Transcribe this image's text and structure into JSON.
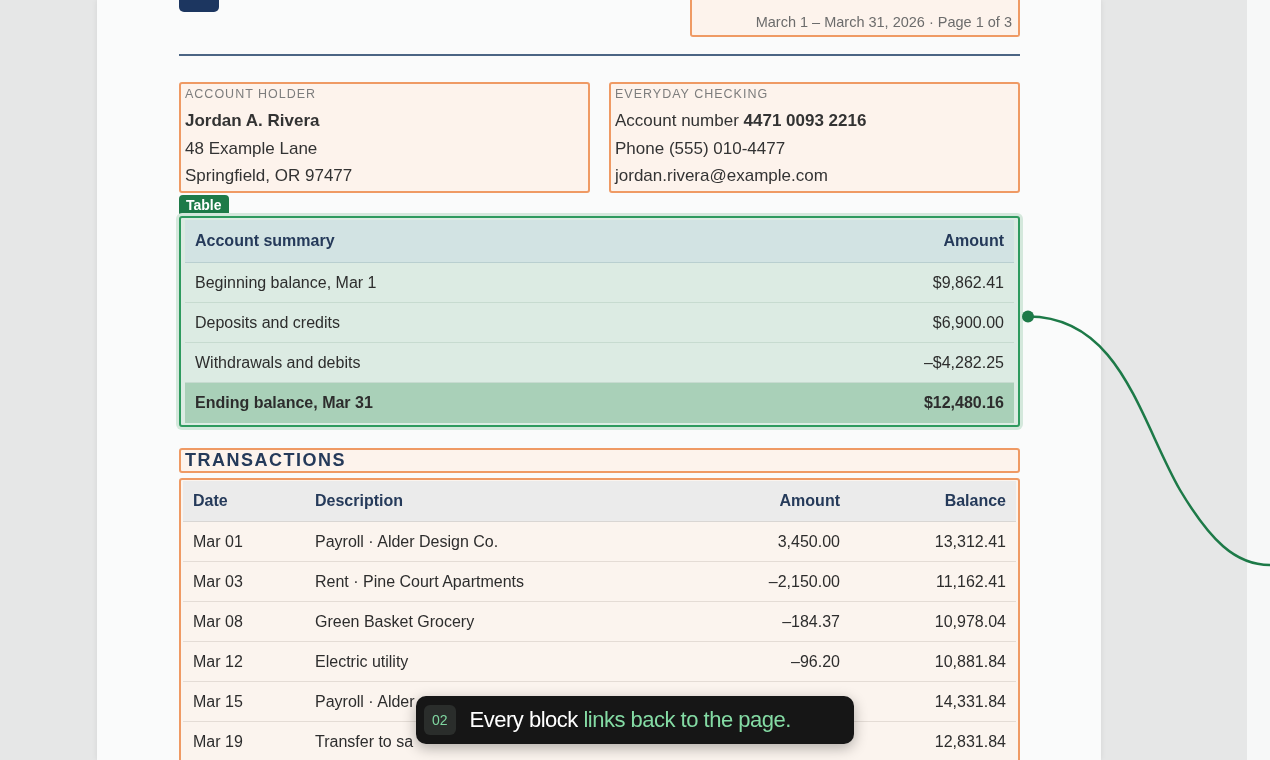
{
  "header": {
    "period": "March 1 – March 31, 2026 · Page 1 of 3"
  },
  "holder": {
    "label": "ACCOUNT HOLDER",
    "name": "Jordan A. Rivera",
    "lines": [
      "48 Example Lane",
      "Springfield, OR 97477"
    ]
  },
  "account": {
    "label": "EVERYDAY CHECKING",
    "number_label": "Account number ",
    "number": "4471 0093 2216",
    "lines": [
      "Phone (555) 010-4477",
      "jordan.rivera@example.com"
    ]
  },
  "summary": {
    "tag": "Table",
    "columns": [
      "Account summary",
      "Amount"
    ],
    "rows": [
      {
        "kind": "line",
        "label": "Beginning balance, Mar 1",
        "amount": "$9,862.41"
      },
      {
        "kind": "line",
        "label": "Deposits and credits",
        "amount": "$6,900.00",
        "linked": true
      },
      {
        "kind": "line",
        "label": "Withdrawals and debits",
        "amount": "–$4,282.25"
      },
      {
        "kind": "total",
        "label": "Ending balance, Mar 31",
        "amount": "$12,480.16"
      }
    ]
  },
  "transactions": {
    "title": "TRANSACTIONS",
    "columns": [
      "Date",
      "Description",
      "Amount",
      "Balance"
    ],
    "rows": [
      {
        "date": "Mar 01",
        "description": "Payroll · Alder Design Co.",
        "amount": "3,450.00",
        "balance": "13,312.41"
      },
      {
        "date": "Mar 03",
        "description": "Rent · Pine Court Apartments",
        "amount": "–2,150.00",
        "balance": "11,162.41"
      },
      {
        "date": "Mar 08",
        "description": "Green Basket Grocery",
        "amount": "–184.37",
        "balance": "10,978.04"
      },
      {
        "date": "Mar 12",
        "description": "Electric utility",
        "amount": "–96.20",
        "balance": "10,881.84"
      },
      {
        "date": "Mar 15",
        "description": "Payroll · Alder",
        "balance": "14,331.84"
      },
      {
        "date": "Mar 19",
        "description": "Transfer to sa",
        "balance": "12,831.84"
      }
    ]
  },
  "caption": {
    "step": "02",
    "text": "Every block ",
    "highlight": "links back to the page."
  }
}
